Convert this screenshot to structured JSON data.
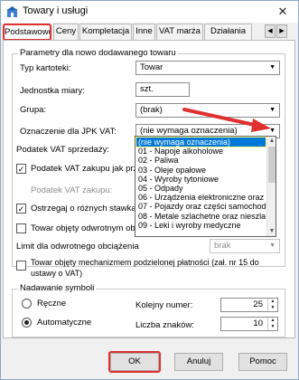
{
  "window": {
    "title": "Towary i usługi",
    "close_glyph": "✕"
  },
  "tabs": [
    {
      "label": "Podstawowe"
    },
    {
      "label": "Ceny"
    },
    {
      "label": "Kompletacja"
    },
    {
      "label": "Inne"
    },
    {
      "label": "VAT marża"
    },
    {
      "label": "Działania"
    }
  ],
  "tab_nav": {
    "prev": "◀",
    "next": "▶"
  },
  "params": {
    "title": "Parametry dla nowo dodawanego towaru",
    "typ_label": "Typ kartoteki:",
    "typ_value": "Towar",
    "jm_label": "Jednostka miary:",
    "jm_value": "szt.",
    "grupa_label": "Grupa:",
    "grupa_value": "(brak)",
    "jpk_label": "Oznaczenie dla JPK VAT:",
    "jpk_value": "(nie wymaga oznaczenia)",
    "vat_sprzedazy_label": "Podatek VAT sprzedaży:",
    "vat_zakupu_cb": "Podatek VAT zakupu jak prz",
    "vat_zakupu_label": "Podatek VAT zakupu:",
    "ostrzegaj_cb": "Ostrzegaj o różnych stawka",
    "odwrotnym_cb": "Towar objęty odwrotnym ob",
    "limit_label": "Limit dla odwrotnego obciążenia",
    "limit_value": "brak",
    "mpp_cb_line1": "Towar objęty mechanizmem podzielonej płatności (zał. nr 15 do",
    "mpp_cb_line2": "ustawy o VAT)"
  },
  "jpk_options": [
    "(nie wymaga oznaczenia)",
    "01 - Napoje alkoholowe",
    "02 - Paliwa",
    "03 - Oleje opałowe",
    "04 - Wyroby tytoniowe",
    "05 - Odpady",
    "06 - Urządzenia elektroniczne oraz",
    "07 - Pojazdy oraz części samochod",
    "08 - Metale szlachetne oraz nieszla",
    "09 - Leki i wyroby medyczne"
  ],
  "symbols": {
    "title": "Nadawanie symboli",
    "manual": "Ręczne",
    "auto": "Automatyczne",
    "kolejny_label": "Kolejny numer:",
    "kolejny_value": "25",
    "liczba_label": "Liczba znaków:",
    "liczba_value": "10"
  },
  "buttons": {
    "ok": "OK",
    "cancel": "Anuluj",
    "help": "Pomoc"
  },
  "icons": {
    "check": "✓",
    "dropdown": "▼",
    "spin_up": "▲",
    "spin_down": "▼",
    "scroll_up": "▲",
    "scroll_down": "▼"
  },
  "colors": {
    "highlight": "#e03030",
    "selection": "#0078d7",
    "arrow": "#e03030"
  }
}
